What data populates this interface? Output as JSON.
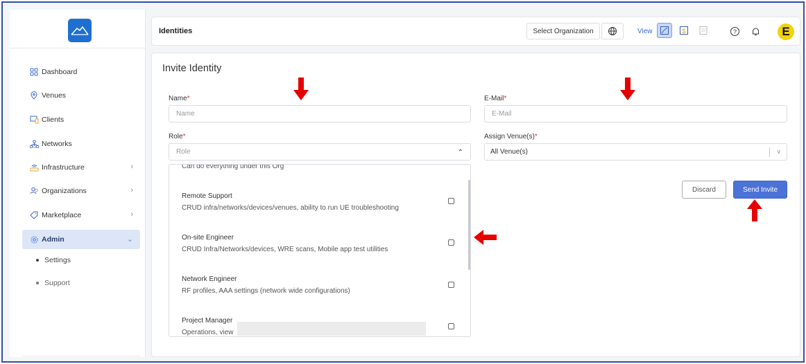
{
  "sidebar": {
    "items": [
      {
        "label": "Dashboard"
      },
      {
        "label": "Venues"
      },
      {
        "label": "Clients"
      },
      {
        "label": "Networks"
      },
      {
        "label": "Infrastructure"
      },
      {
        "label": "Organizations"
      },
      {
        "label": "Marketplace"
      },
      {
        "label": "Admin"
      }
    ],
    "sub_items": [
      {
        "label": "Settings"
      },
      {
        "label": "Support"
      }
    ]
  },
  "header": {
    "title": "Identities",
    "select_org_label": "Select Organization",
    "view_label": "View",
    "avatar_letter": "E"
  },
  "form": {
    "title": "Invite Identity",
    "name_label": "Name",
    "name_placeholder": "Name",
    "email_label": "E-Mail",
    "email_placeholder": "E-Mail",
    "role_label": "Role",
    "role_placeholder": "Role",
    "venue_label": "Assign Venue(s)",
    "venue_value": "All Venue(s)",
    "required_mark": "*",
    "discard_label": "Discard",
    "send_label": "Send Invite"
  },
  "roles": {
    "partial_top": "Can do everything under this Org",
    "options": [
      {
        "name": "Remote Support",
        "desc": "CRUD infra/networks/devices/venues, ability to run UE troubleshooting"
      },
      {
        "name": "On-site Engineer",
        "desc": "CRUD Infra/Networks/devices, WRE scans, Mobile app test utilities"
      },
      {
        "name": "Network Engineer",
        "desc": "RF profiles, AAA settings (network wide configurations)"
      },
      {
        "name": "Project Manager",
        "desc": "Operations, view"
      }
    ]
  },
  "colors": {
    "accent": "#4b72d6",
    "frame": "#2f4fa8",
    "annotation_arrow": "#e60000",
    "avatar": "#f2d30a"
  }
}
